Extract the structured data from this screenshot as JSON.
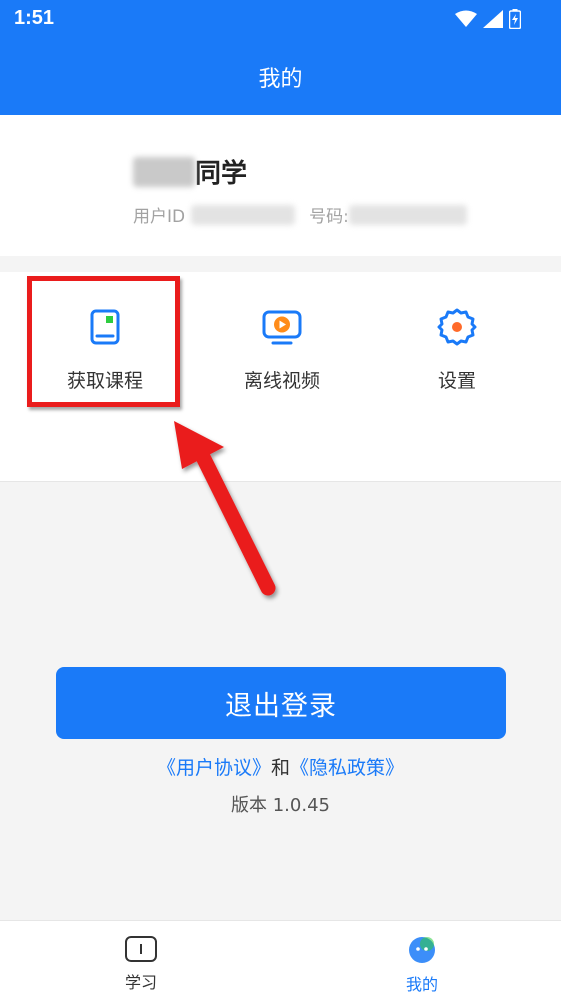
{
  "status": {
    "time": "1:51"
  },
  "header": {
    "title": "我的"
  },
  "profile": {
    "name_suffix": "同学",
    "user_id_label": "用户ID",
    "phone_label": "号码:"
  },
  "menu": {
    "items": [
      {
        "label": "获取课程",
        "icon": "course-book-icon"
      },
      {
        "label": "离线视频",
        "icon": "offline-video-icon"
      },
      {
        "label": "设置",
        "icon": "settings-gear-icon"
      }
    ]
  },
  "actions": {
    "logout_label": "退出登录"
  },
  "legal": {
    "user_agreement": "《用户协议》",
    "connector": "和",
    "privacy_policy": "《隐私政策》"
  },
  "version": "版本 1.0.45",
  "tabs": [
    {
      "label": "学习",
      "icon": "study-book-icon",
      "active": false
    },
    {
      "label": "我的",
      "icon": "profile-face-icon",
      "active": true
    }
  ],
  "colors": {
    "primary": "#1a7af8",
    "highlight_annotation": "#ea1c1c",
    "accent_green": "#2ecc40",
    "accent_orange": "#ff6a2a"
  }
}
